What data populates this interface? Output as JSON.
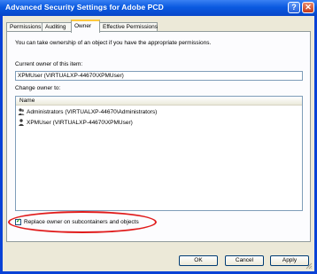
{
  "window": {
    "title": "Advanced Security Settings for Adobe PCD",
    "help_glyph": "?",
    "close_glyph": "✕"
  },
  "tabs": [
    {
      "label": "Permissions"
    },
    {
      "label": "Auditing"
    },
    {
      "label": "Owner",
      "active": true
    },
    {
      "label": "Effective Permissions"
    }
  ],
  "owner_tab": {
    "intro": "You can take ownership of an object if you have the appropriate permissions.",
    "current_owner_label": "Current owner of this item:",
    "current_owner_value": "XPMUser (VIRTUALXP-44670\\XPMUser)",
    "change_owner_label": "Change owner to:",
    "list_header": "Name",
    "owners": [
      {
        "name": "Administrators (VIRTUALXP-44670\\Administrators)",
        "icon": "user-group-icon"
      },
      {
        "name": "XPMUser (VIRTUALXP-44670\\XPMUser)",
        "icon": "user-icon"
      }
    ],
    "replace_checkbox_label": "Replace owner on subcontainers and objects",
    "replace_checked": true
  },
  "buttons": {
    "ok": "OK",
    "cancel": "Cancel",
    "apply": "Apply"
  },
  "colors": {
    "title_bar": "#0a5ae0",
    "highlight_ellipse": "#e01b1b"
  }
}
